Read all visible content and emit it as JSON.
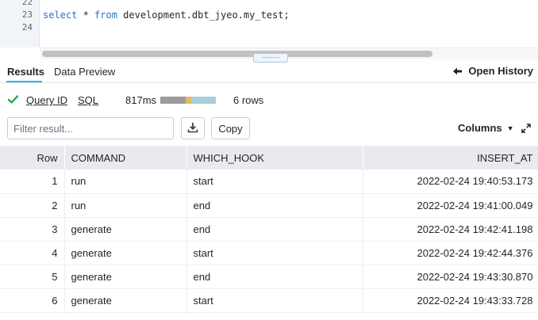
{
  "editor": {
    "lines": [
      {
        "num": "22",
        "tokens": []
      },
      {
        "num": "23",
        "tokens": [
          {
            "text": "select",
            "kw": true
          },
          {
            "text": " * ",
            "kw": false
          },
          {
            "text": "from",
            "kw": true
          },
          {
            "text": " development.dbt_jyeo.my_test;",
            "kw": false
          }
        ]
      },
      {
        "num": "24",
        "tokens": []
      }
    ]
  },
  "tabs": {
    "results_label": "Results",
    "preview_label": "Data Preview",
    "history_label": "Open History"
  },
  "status": {
    "query_id_label": "Query ID",
    "sql_label": "SQL",
    "duration": "817ms",
    "rows": "6 rows",
    "timing_segments": [
      {
        "fraction": 0.46,
        "color": "#9b9b9b"
      },
      {
        "fraction": 0.1,
        "color": "#e2b86b"
      },
      {
        "fraction": 0.44,
        "color": "#a9cedb"
      }
    ]
  },
  "toolbar": {
    "filter_placeholder": "Filter result...",
    "filter_value": "",
    "copy_label": "Copy",
    "columns_label": "Columns"
  },
  "table": {
    "columns": [
      "Row",
      "COMMAND",
      "WHICH_HOOK",
      "INSERT_AT"
    ],
    "rows": [
      [
        "1",
        "run",
        "start",
        "2022-02-24 19:40:53.173"
      ],
      [
        "2",
        "run",
        "end",
        "2022-02-24 19:41:00.049"
      ],
      [
        "3",
        "generate",
        "end",
        "2022-02-24 19:42:41.198"
      ],
      [
        "4",
        "generate",
        "start",
        "2022-02-24 19:42:44.376"
      ],
      [
        "5",
        "generate",
        "end",
        "2022-02-24 19:43:30.870"
      ],
      [
        "6",
        "generate",
        "start",
        "2022-02-24 19:43:33.728"
      ]
    ]
  },
  "colors": {
    "accent": "#29b5e8",
    "success": "#2ea44f",
    "keyword": "#2b6fd6"
  },
  "icons": {
    "check": "check-icon",
    "history_arrow": "arrow-left-icon",
    "download": "download-icon",
    "expand": "expand-icon"
  }
}
